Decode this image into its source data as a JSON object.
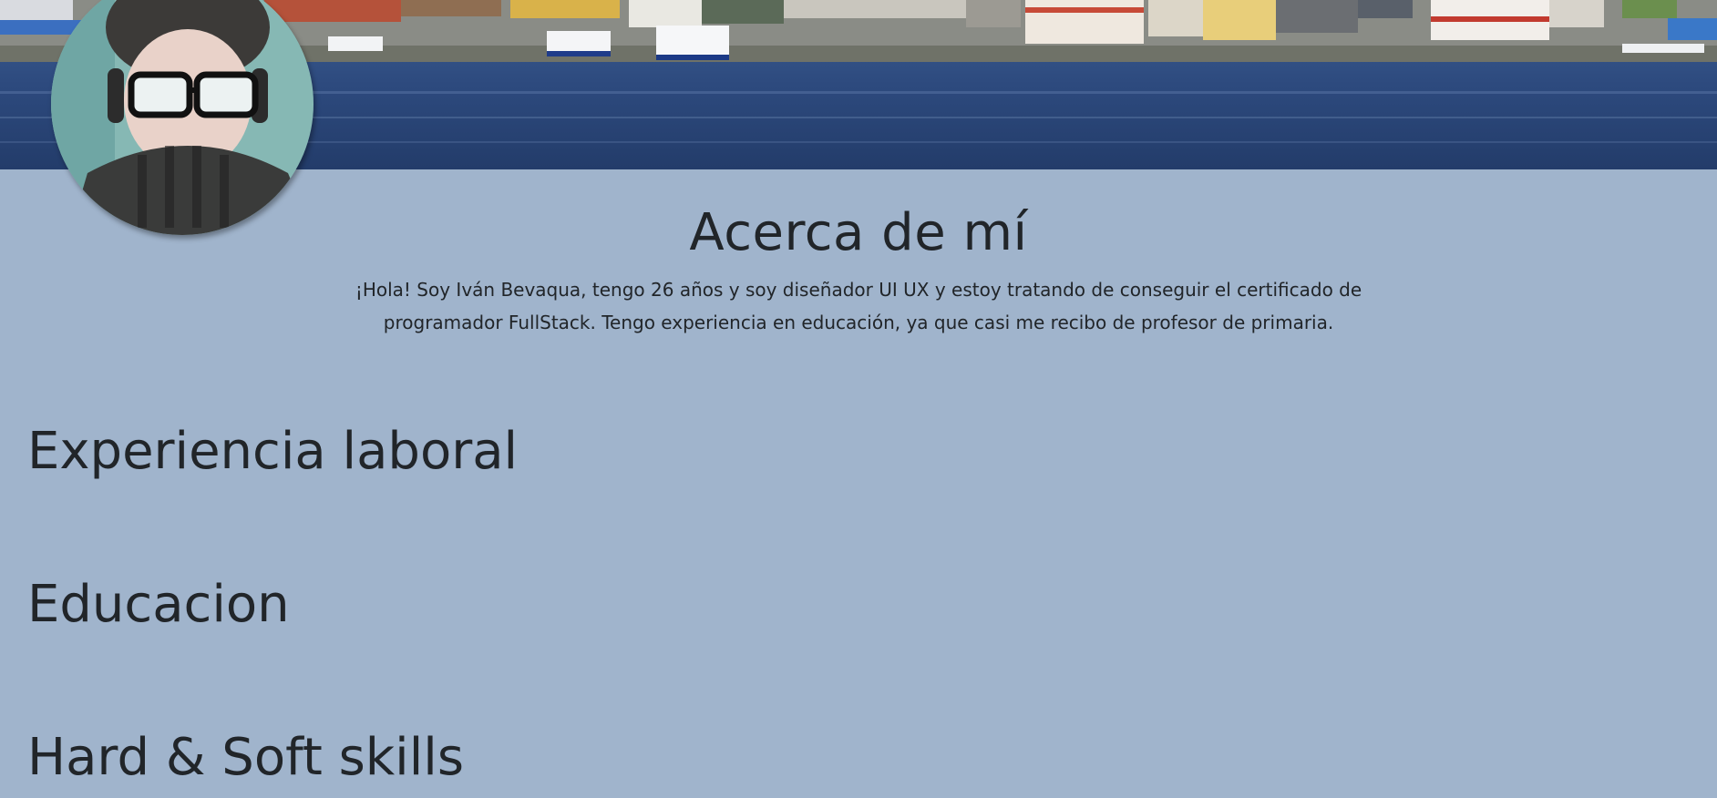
{
  "about": {
    "title": "Acerca de mí",
    "text": "¡Hola! Soy Iván Bevaqua, tengo 26 años y soy diseñador UI UX y estoy tratando de conseguir el certificado de programador FullStack. Tengo experiencia en educación, ya que casi me recibo de profesor de primaria."
  },
  "sections": {
    "experience": "Experiencia laboral",
    "education": "Educacion",
    "skills": "Hard & Soft skills"
  },
  "colors": {
    "page_background": "#a0b4cc",
    "text": "#212529",
    "water": "#2f4f86"
  }
}
